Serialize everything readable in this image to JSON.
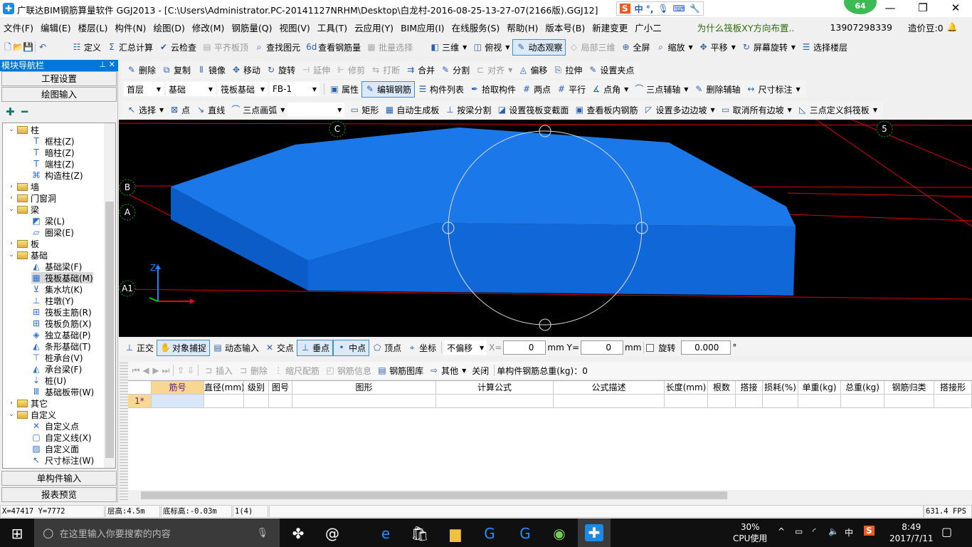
{
  "title": {
    "text": "广联达BIM钢筋算量软件 GGJ2013 - [C:\\Users\\Administrator.PC-20141127NRHM\\Desktop\\白龙村-2016-08-25-13-27-07(2166版).GGJ12]",
    "badge": "64",
    "ime": "中 °,"
  },
  "menu": [
    "文件(F)",
    "编辑(E)",
    "楼层(L)",
    "构件(N)",
    "绘图(D)",
    "修改(M)",
    "钢筋量(Q)",
    "视图(V)",
    "工具(T)",
    "云应用(Y)",
    "BIM应用(I)",
    "在线服务(S)",
    "帮助(H)",
    "版本号(B)",
    "新建变更",
    "广小二"
  ],
  "menu_extra": {
    "hint": "为什么筏板XY方向布置..",
    "user": "13907298339",
    "beans": "造价豆:0"
  },
  "toolbar1": [
    {
      "l": "定义",
      "i": "☷"
    },
    {
      "l": "汇总计算",
      "i": "Σ"
    },
    {
      "l": "云检查",
      "i": "✔"
    },
    {
      "l": "平齐板顶",
      "i": "▤",
      "d": 1
    },
    {
      "l": "查找图元",
      "i": "⌕"
    },
    {
      "l": "查看钢筋量",
      "i": "6d"
    },
    {
      "l": "批量选择",
      "i": "▦",
      "d": 1
    },
    {
      "l": "三维",
      "i": "◧",
      "dd": 1
    },
    {
      "l": "俯视",
      "i": "◫",
      "dd": 1
    },
    {
      "l": "动态观察",
      "i": "✎",
      "a": 1
    },
    {
      "l": "局部三维",
      "i": "◇",
      "d": 1
    },
    {
      "l": "全屏",
      "i": "⊕"
    },
    {
      "l": "缩放",
      "i": "⌕",
      "dd": 1
    },
    {
      "l": "平移",
      "i": "✥",
      "dd": 1
    },
    {
      "l": "屏幕旋转",
      "i": "↻",
      "dd": 1
    },
    {
      "l": "选择楼层",
      "i": "☰"
    }
  ],
  "toolbar2": [
    {
      "l": "删除",
      "i": "✎"
    },
    {
      "l": "复制",
      "i": "⧉"
    },
    {
      "l": "镜像",
      "i": "⫴"
    },
    {
      "l": "移动",
      "i": "✥"
    },
    {
      "l": "旋转",
      "i": "↻"
    },
    {
      "l": "延伸",
      "i": "⊣",
      "d": 1
    },
    {
      "l": "修剪",
      "i": "⊩",
      "d": 1
    },
    {
      "l": "打断",
      "i": "⇆",
      "d": 1
    },
    {
      "l": "合并",
      "i": "⇉"
    },
    {
      "l": "分割",
      "i": "✎"
    },
    {
      "l": "对齐",
      "i": "⊏",
      "d": 1,
      "dd": 1
    },
    {
      "l": "偏移",
      "i": "◬"
    },
    {
      "l": "拉伸",
      "i": "⎘"
    },
    {
      "l": "设置夹点",
      "i": "✎"
    }
  ],
  "selectors": {
    "floor": "首层",
    "type": "基础",
    "component": "筏板基础",
    "name": "FB-1"
  },
  "toolbar3": [
    {
      "l": "属性",
      "i": "▣"
    },
    {
      "l": "编辑钢筋",
      "i": "✎",
      "a": 1
    },
    {
      "l": "构件列表",
      "i": "☰"
    },
    {
      "l": "拾取构件",
      "i": "✒"
    },
    {
      "l": "两点",
      "i": "#"
    },
    {
      "l": "平行",
      "i": "#"
    },
    {
      "l": "点角",
      "i": "∡",
      "dd": 1
    },
    {
      "l": "三点辅轴",
      "i": "⌒",
      "dd": 1
    },
    {
      "l": "删除辅轴",
      "i": "✎"
    },
    {
      "l": "尺寸标注",
      "i": "↔",
      "dd": 1
    }
  ],
  "toolbar4": [
    {
      "l": "选择",
      "i": "↖",
      "dd": 1
    },
    {
      "l": "点",
      "i": "⊠"
    },
    {
      "l": "直线",
      "i": "↘"
    },
    {
      "l": "三点画弧",
      "i": "⌒",
      "dd": 1
    },
    {
      "l": "",
      "i": "",
      "dd": 1,
      "blank": 1
    },
    {
      "l": "矩形",
      "i": "▭"
    },
    {
      "l": "自动生成板",
      "i": "▦"
    },
    {
      "l": "按梁分割",
      "i": "⊥"
    },
    {
      "l": "设置筏板变截面",
      "i": "◪"
    },
    {
      "l": "查看板内钢筋",
      "i": "▣"
    },
    {
      "l": "设置多边边坡",
      "i": "◸",
      "dd": 1
    },
    {
      "l": "取消所有边坡",
      "i": "▭",
      "dd": 1
    },
    {
      "l": "三点定义斜筏板",
      "i": "◺",
      "dd": 1
    }
  ],
  "nav": {
    "title": "模块导航栏",
    "project": "工程设置",
    "drawing": "绘图输入",
    "single": "单构件输入",
    "report": "报表预览"
  },
  "tree": [
    {
      "l": "柱",
      "lv": 0,
      "f": 1,
      "o": 1
    },
    {
      "l": "框柱(Z)",
      "lv": 1,
      "i": "T"
    },
    {
      "l": "暗柱(Z)",
      "lv": 1,
      "i": "T"
    },
    {
      "l": "端柱(Z)",
      "lv": 1,
      "i": "T"
    },
    {
      "l": "构造柱(Z)",
      "lv": 1,
      "i": "⌘"
    },
    {
      "l": "墙",
      "lv": 0,
      "f": 1
    },
    {
      "l": "门窗洞",
      "lv": 0,
      "f": 1
    },
    {
      "l": "梁",
      "lv": 0,
      "f": 1,
      "o": 1
    },
    {
      "l": "梁(L)",
      "lv": 1,
      "i": "◩"
    },
    {
      "l": "圈梁(E)",
      "lv": 1,
      "i": "▱"
    },
    {
      "l": "板",
      "lv": 0,
      "f": 1
    },
    {
      "l": "基础",
      "lv": 0,
      "f": 1,
      "o": 1
    },
    {
      "l": "基础梁(F)",
      "lv": 1,
      "i": "◭"
    },
    {
      "l": "筏板基础(M)",
      "lv": 1,
      "i": "▦",
      "s": 1
    },
    {
      "l": "集水坑(K)",
      "lv": 1,
      "i": "⊻"
    },
    {
      "l": "柱墩(Y)",
      "lv": 1,
      "i": "⊥"
    },
    {
      "l": "筏板主筋(R)",
      "lv": 1,
      "i": "⊞"
    },
    {
      "l": "筏板负筋(X)",
      "lv": 1,
      "i": "⊞"
    },
    {
      "l": "独立基础(P)",
      "lv": 1,
      "i": "◈"
    },
    {
      "l": "条形基础(T)",
      "lv": 1,
      "i": "◭"
    },
    {
      "l": "桩承台(V)",
      "lv": 1,
      "i": "⊤"
    },
    {
      "l": "承台梁(F)",
      "lv": 1,
      "i": "◭"
    },
    {
      "l": "桩(U)",
      "lv": 1,
      "i": "⇣"
    },
    {
      "l": "基础板带(W)",
      "lv": 1,
      "i": "Ⅲ"
    },
    {
      "l": "其它",
      "lv": 0,
      "f": 1
    },
    {
      "l": "自定义",
      "lv": 0,
      "f": 1,
      "o": 1
    },
    {
      "l": "自定义点",
      "lv": 1,
      "i": "✕"
    },
    {
      "l": "自定义线(X)",
      "lv": 1,
      "i": "▢"
    },
    {
      "l": "自定义面",
      "lv": 1,
      "i": "▨"
    },
    {
      "l": "尺寸标注(W)",
      "lv": 1,
      "i": "↖"
    }
  ],
  "viewport": {
    "axes": [
      "C",
      "5",
      "B",
      "A",
      "A1"
    ],
    "z_label": "Z",
    "slab_color": "#1a78e8"
  },
  "snapbar": {
    "items": [
      {
        "l": "正交",
        "i": "⊥"
      },
      {
        "l": "对象捕捉",
        "i": "✋",
        "a": 1
      },
      {
        "l": "动态输入",
        "i": "▤"
      },
      {
        "l": "交点",
        "i": "✕"
      },
      {
        "l": "垂点",
        "i": "⊥",
        "a": 1
      },
      {
        "l": "中点",
        "i": "•",
        "a": 1
      },
      {
        "l": "顶点",
        "i": "⬠"
      },
      {
        "l": "坐标",
        "i": "⌖"
      }
    ],
    "offset": "不偏移",
    "x_label": "X=",
    "x": "0",
    "mm": "mm",
    "y_label": "Y=",
    "y": "0",
    "rotate": "旋转",
    "angle": "0.000",
    "deg": "°"
  },
  "rebarbar": {
    "items": [
      {
        "l": "插入",
        "i": "⊐",
        "d": 1
      },
      {
        "l": "删除",
        "i": "⊐",
        "d": 1
      },
      {
        "l": "缩尺配筋",
        "i": "⋮",
        "d": 1
      },
      {
        "l": "钢筋信息",
        "i": "◰",
        "d": 1
      },
      {
        "l": "钢筋图库",
        "i": "▤"
      },
      {
        "l": "其他",
        "i": "⇨",
        "dd": 1
      },
      {
        "l": "关闭",
        "i": ""
      }
    ],
    "total": "单构件钢筋总重(kg)：0"
  },
  "grid": {
    "columns": [
      "筋号",
      "直径(mm)",
      "级别",
      "图号",
      "图形",
      "计算公式",
      "公式描述",
      "长度(mm)",
      "根数",
      "搭接",
      "损耗(%)",
      "单重(kg)",
      "总重(kg)",
      "钢筋归类",
      "搭接形"
    ],
    "rows": [
      {
        "num": "1*"
      }
    ]
  },
  "status": {
    "coords": "X=47417 Y=7772",
    "floor_height": "层高:4.5m",
    "base_elev": "底标高:-0.03m",
    "count": "1(4)",
    "fps": "631.4 FPS"
  },
  "taskbar": {
    "search": "在这里输入你要搜索的内容",
    "cpu": "30%",
    "cpu_label": "CPU使用",
    "ime": "中",
    "time": "8:49",
    "date": "2017/7/11"
  }
}
